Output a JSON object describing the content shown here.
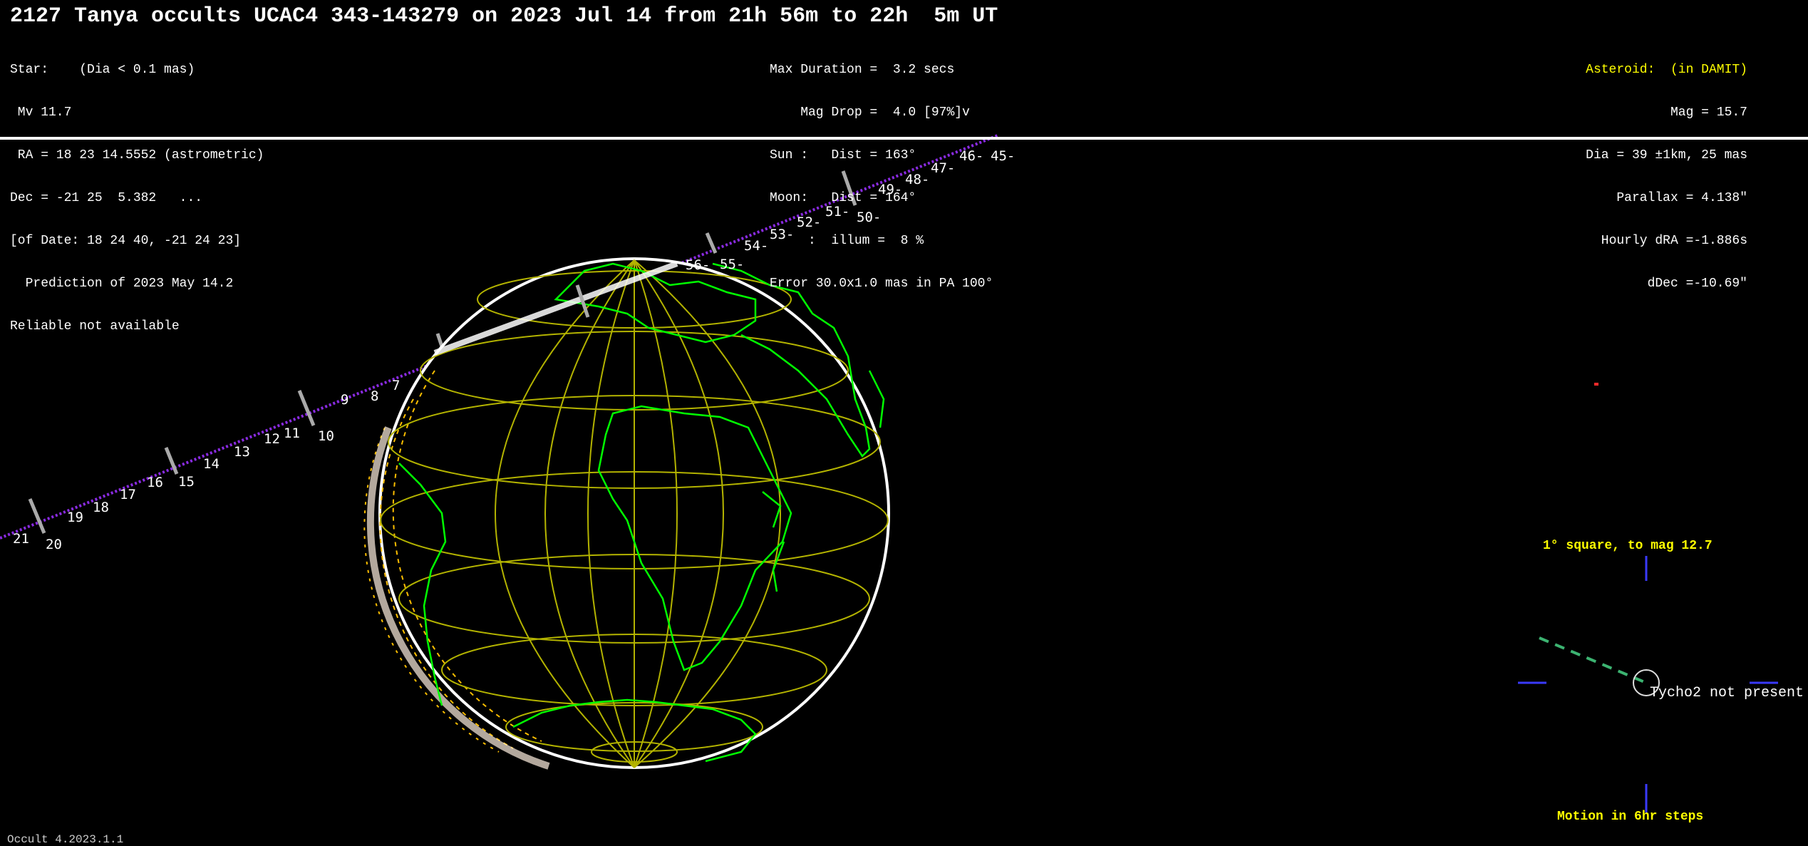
{
  "header": {
    "title": "2127 Tanya occults UCAC4 343-143279 on 2023 Jul 14 from 21h 56m to 22h  5m UT",
    "left_lines": [
      "Star:    (Dia < 0.1 mas)",
      " Mv 11.7",
      " RA = 18 23 14.5552 (astrometric)",
      "Dec = -21 25  5.382   ...",
      "[of Date: 18 24 40, -21 24 23]",
      "  Prediction of 2023 May 14.2",
      "Reliable not available"
    ],
    "center_lines": [
      "Max Duration =  3.2 secs",
      "    Mag Drop =  4.0 [97%]v",
      "Sun :   Dist = 163°",
      "Moon:   Dist = 164°",
      "     :  illum =  8 %",
      "Error 30.0x1.0 mas in PA 100°"
    ],
    "right_title": "Asteroid:  (in DAMIT)",
    "right_lines": [
      "Mag = 15.7",
      "Dia = 39 ±1km, 25 mas",
      "Parallax = 4.138\"",
      "Hourly dRA =-1.886s",
      "dDec =-10.69\""
    ]
  },
  "path_ticks": [
    "21",
    "20",
    "19",
    "18",
    "17",
    "16",
    "15",
    "14",
    "13",
    "12",
    "11",
    "10",
    "9",
    "8",
    "7",
    "56-",
    "55-",
    "54-",
    "53-",
    "52-",
    "51-",
    "50-",
    "49-",
    "48-",
    "47-",
    "46-",
    "45-"
  ],
  "star_chart": {
    "title": "1° square, to mag 12.7",
    "note": "Tycho2 not present",
    "footer": "Motion in 6hr steps"
  },
  "footer": {
    "label": "Occult 4.2023.1.1"
  },
  "colors": {
    "coast": "#00ff00",
    "grid": "#b3b300",
    "path": "#8a2be2",
    "accent": "#ffff00"
  }
}
